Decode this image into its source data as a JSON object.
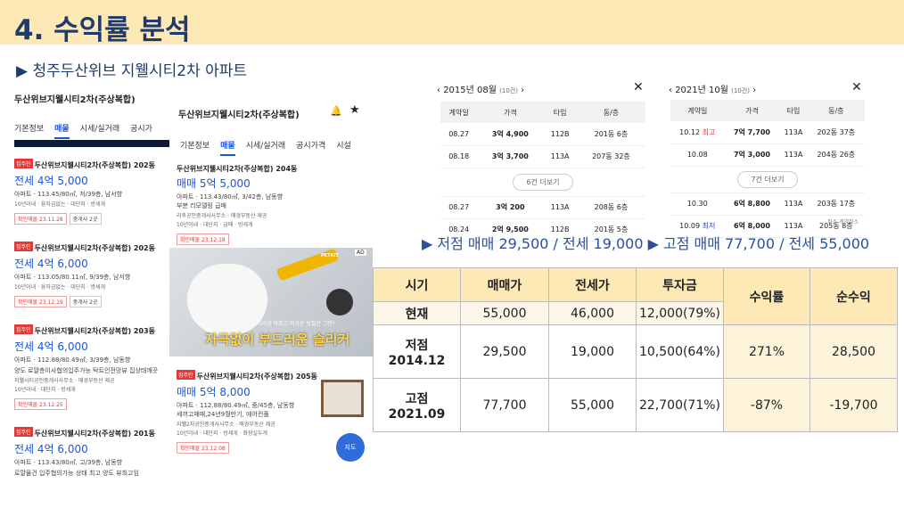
{
  "header": {
    "title": "4. 수익률 분석",
    "subtitle": "▶ 청주두산위브 지웰시티2차 아파트"
  },
  "left_screen": {
    "app_title": "두산위브지웰시티2차(주상복합)",
    "tabs": [
      "기본정보",
      "매물",
      "시세/실거래",
      "공시가"
    ],
    "listings": [
      {
        "tag": "집주인",
        "name": "두산위브지웰시티2차(주상복합) 202동",
        "price": "전세 4억 5,000",
        "info": "아파트 · 113.45/80㎡, 저/39층, 남서향",
        "chips": "10년이내 · 융자금없는 · 대단지 · 방세개",
        "confirm": "확인매물 23.11.28",
        "broker": "중개사 2곳"
      },
      {
        "tag": "집주인",
        "name": "두산위브지웰시티2차(주상복합) 202동",
        "price": "전세 4억 6,000",
        "info": "아파트 · 113.05/80.11㎡, 9/39층, 남서향",
        "chips": "10년이내 · 융자금없는 · 대단지 · 방세개",
        "confirm": "확인매물 23.12.19",
        "broker": "중개사 2곳"
      },
      {
        "tag": "집주인",
        "name": "두산위브지웰시티2차(주상복합) 203동",
        "price": "전세 4억 6,000",
        "info": "아파트 · 112.88/80.49㎡, 3/39층, 남동향",
        "info2": "양도 로얄층이사협의입주가능 탁트인전망뷰 집상태깨끗",
        "chips2": "지웰시티공인중개사사무소 · 매경부동산 제공",
        "chips": "10년이내 · 대단지 · 방세개",
        "confirm": "확인매물 23.12.25"
      },
      {
        "tag": "집주인",
        "name": "두산위브지웰시티2차(주상복합) 201동",
        "price": "전세 4억 6,000",
        "info": "아파트 · 113.43/80㎡, 고/39층, 남동향",
        "info2": "로얄물건 입주협의가능 상태 최고 양도 뷰최고임"
      }
    ]
  },
  "mid_screen": {
    "app_title": "두산위브지웰시티2차(주상복합)",
    "tabs": [
      "기본정보",
      "매물",
      "시세/실거래",
      "공시가격",
      "시설"
    ],
    "listing1": {
      "name": "두산위브지웰시티2차(주상복합) 204동",
      "price": "매매 5억 5,000",
      "info": "아파트 · 113.43/80㎡, 3/42층, 남동향",
      "info2": "부분 리모델링 급매",
      "office": "리후공인중개사사무소 · 매경부동산 제공",
      "chips": "10년이내 · 대단지 · 급매 · 방세개",
      "confirm": "확인매물 23.12.18"
    },
    "ad": {
      "badge": "AD",
      "brand": "PETKIT",
      "bubble": "더이상 아프고 따가운 빗질은 그만!",
      "headline": "자극없이 부드러운 슬리커"
    },
    "listing2": {
      "tag": "집주인",
      "name": "두산위브지웰시티2차(주상복합) 205동",
      "price": "매매 5억 8,000",
      "info": "아파트 · 112.88/80.49㎡, 중/45층, 남동향",
      "info2": "세끼고매매,24년9월만기, 에어컨풀",
      "office": "지웰2차공인중개사사무소 · 매경부동산 제공",
      "chips": "10년이내 · 대단지 · 방세개 · 화장실두개",
      "confirm": "확인매물 23.12.08"
    },
    "map_label": "지도"
  },
  "panel1": {
    "title": "2015년 08월",
    "count": "(10건)",
    "cols": [
      "계약일",
      "가격",
      "타입",
      "동/층"
    ],
    "rows_top": [
      [
        "08.27",
        "3억 4,900",
        "112B",
        "201동 6층"
      ],
      [
        "08.18",
        "3억 3,700",
        "113A",
        "207동 32층"
      ]
    ],
    "more": "6건 더보기",
    "rows_bottom": [
      [
        "08.27",
        "3억 200",
        "113A",
        "208동 6층"
      ],
      [
        "08.24",
        "2억 9,500",
        "112B",
        "201동 5층"
      ]
    ]
  },
  "panel2": {
    "title": "2021년 10월",
    "count": "(10건)",
    "cols": [
      "계약일",
      "가격",
      "타입",
      "동/층"
    ],
    "rows_top": [
      [
        "10.12",
        "최고",
        "7억 7,700",
        "113A",
        "202동 37층"
      ],
      [
        "10.08",
        "",
        "7억 3,000",
        "113A",
        "204동 26층"
      ]
    ],
    "more": "7건 더보기",
    "rows_bottom": [
      [
        "10.30",
        "",
        "6억 8,800",
        "113A",
        "203동 17층"
      ],
      [
        "10.09",
        "최저",
        "6억 8,000",
        "113A",
        "205동 8층"
      ]
    ],
    "footnote": "취소  계약취소"
  },
  "summary": {
    "left": "▶ 저점 매매 29,500 / 전세 19,000",
    "right": "▶ 고점 매매 77,700 / 전세 55,000"
  },
  "table": {
    "headers": [
      "시기",
      "매매가",
      "전세가",
      "투자금",
      "수익률",
      "순수익"
    ],
    "current": [
      "현재",
      "55,000",
      "46,000",
      "12,000(79%)"
    ],
    "low": {
      "label1": "저점",
      "label2": "2014.12",
      "cells": [
        "29,500",
        "19,000",
        "10,500(64%)",
        "271%",
        "28,500"
      ]
    },
    "high": {
      "label1": "고점",
      "label2": "2021.09",
      "cells": [
        "77,700",
        "55,000",
        "22,700(71%)",
        "-87%",
        "-19,700"
      ]
    }
  }
}
